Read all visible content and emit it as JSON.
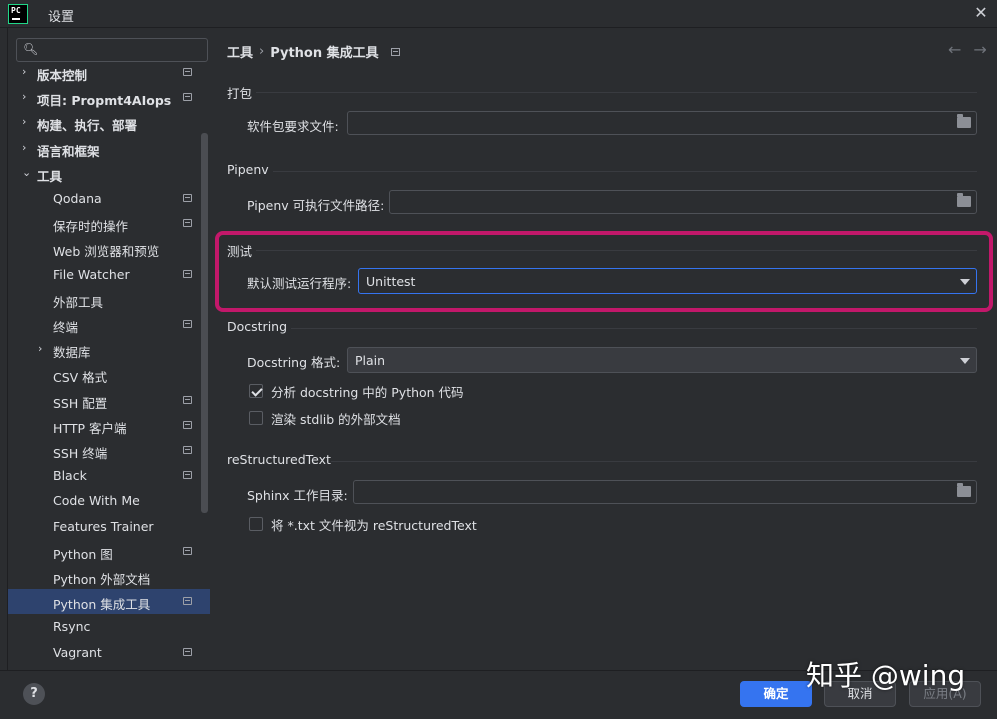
{
  "window": {
    "title": "设置",
    "logo_text": "PC"
  },
  "search": {
    "placeholder": ""
  },
  "sidebar": {
    "items": [
      {
        "label": "版本控制",
        "arrow": "›",
        "pin": true
      },
      {
        "label": "项目: Propmt4AIops",
        "arrow": "›",
        "pin": true
      },
      {
        "label": "构建、执行、部署",
        "arrow": "›",
        "pin": false
      },
      {
        "label": "语言和框架",
        "arrow": "›",
        "pin": false
      },
      {
        "label": "工具",
        "arrow": "⌄",
        "pin": false
      },
      {
        "label": "Qodana",
        "pin": true
      },
      {
        "label": "保存时的操作",
        "pin": true
      },
      {
        "label": "Web 浏览器和预览",
        "pin": false
      },
      {
        "label": "File Watcher",
        "pin": true
      },
      {
        "label": "外部工具",
        "pin": false
      },
      {
        "label": "终端",
        "pin": true
      },
      {
        "label": "数据库",
        "arrow": "›",
        "pin": false
      },
      {
        "label": "CSV 格式",
        "pin": false
      },
      {
        "label": "SSH 配置",
        "pin": true
      },
      {
        "label": "HTTP 客户端",
        "pin": true
      },
      {
        "label": "SSH 终端",
        "pin": true
      },
      {
        "label": "Black",
        "pin": true
      },
      {
        "label": "Code With Me",
        "pin": false
      },
      {
        "label": "Features Trainer",
        "pin": false
      },
      {
        "label": "Python 图",
        "pin": true
      },
      {
        "label": "Python 外部文档",
        "pin": false
      },
      {
        "label": "Python 集成工具",
        "pin": true,
        "selected": true
      },
      {
        "label": "Rsync",
        "pin": false
      },
      {
        "label": "Vagrant",
        "pin": true
      }
    ]
  },
  "breadcrumb": {
    "parent": "工具",
    "separator": "›",
    "current": "Python 集成工具"
  },
  "nav": {
    "back": "←",
    "forward": "→"
  },
  "sections": {
    "packaging": {
      "title": "打包",
      "label": "软件包要求文件:",
      "value": ""
    },
    "pipenv": {
      "title": "Pipenv",
      "label": "Pipenv 可执行文件路径:",
      "value": ""
    },
    "testing": {
      "title": "测试",
      "label": "默认测试运行程序:",
      "value": "Unittest"
    },
    "docstring": {
      "title": "Docstring",
      "label": "Docstring 格式:",
      "value": "Plain",
      "check1": "分析 docstring 中的 Python 代码",
      "check2": "渲染 stdlib 的外部文档"
    },
    "rst": {
      "title": "reStructuredText",
      "label": "Sphinx 工作目录:",
      "value": "",
      "check1": "将 *.txt 文件视为 reStructuredText"
    }
  },
  "footer": {
    "help": "?",
    "ok": "确定",
    "cancel": "取消",
    "apply": "应用(A)"
  },
  "watermark": "知乎 @wing",
  "colors": {
    "accent": "#3574f0",
    "highlight": "#c2186a",
    "selected_row": "#2e436e"
  }
}
